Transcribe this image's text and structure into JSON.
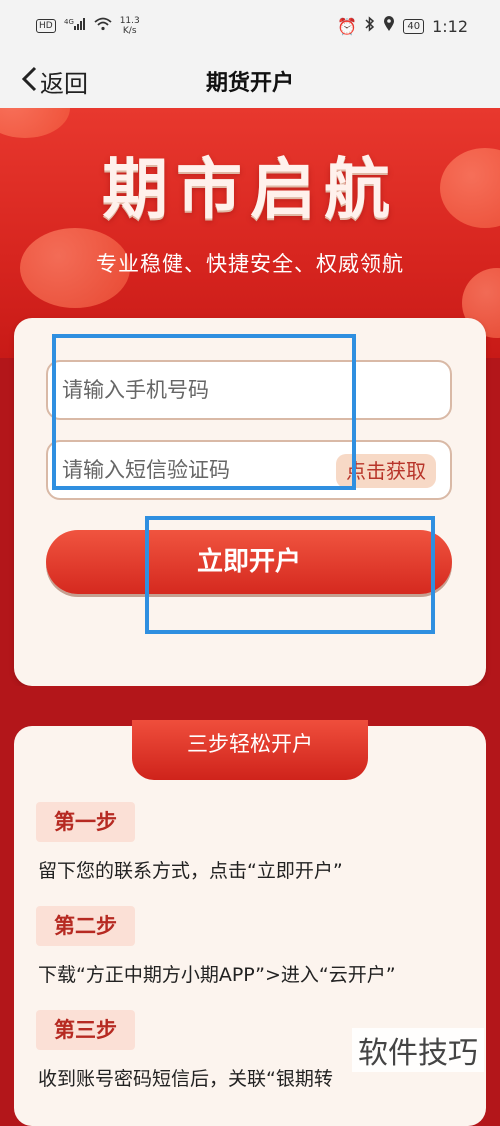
{
  "status": {
    "hd": "HD",
    "network": "4G",
    "speed_value": "11.3",
    "speed_unit": "K/s",
    "battery": "40",
    "time": "1:12"
  },
  "nav": {
    "back_label": "返回",
    "title": "期货开户"
  },
  "hero": {
    "title": "期市启航",
    "subtitle": "专业稳健、快捷安全、权威领航"
  },
  "form": {
    "phone_placeholder": "请输入手机号码",
    "sms_placeholder": "请输入短信验证码",
    "get_code_label": "点击获取",
    "submit_label": "立即开户"
  },
  "steps": {
    "header": "三步轻松开户",
    "items": [
      {
        "tag": "第一步",
        "text": "留下您的联系方式，点击“立即开户”"
      },
      {
        "tag": "第二步",
        "text": "下载“方正中期方小期APP”>进入“云开户”"
      },
      {
        "tag": "第三步",
        "text": "收到账号密码短信后，关联“银期转"
      }
    ]
  },
  "watermark": "软件技巧",
  "colors": {
    "brand_red": "#d7251f",
    "overlay_blue": "#2f8fe0"
  }
}
